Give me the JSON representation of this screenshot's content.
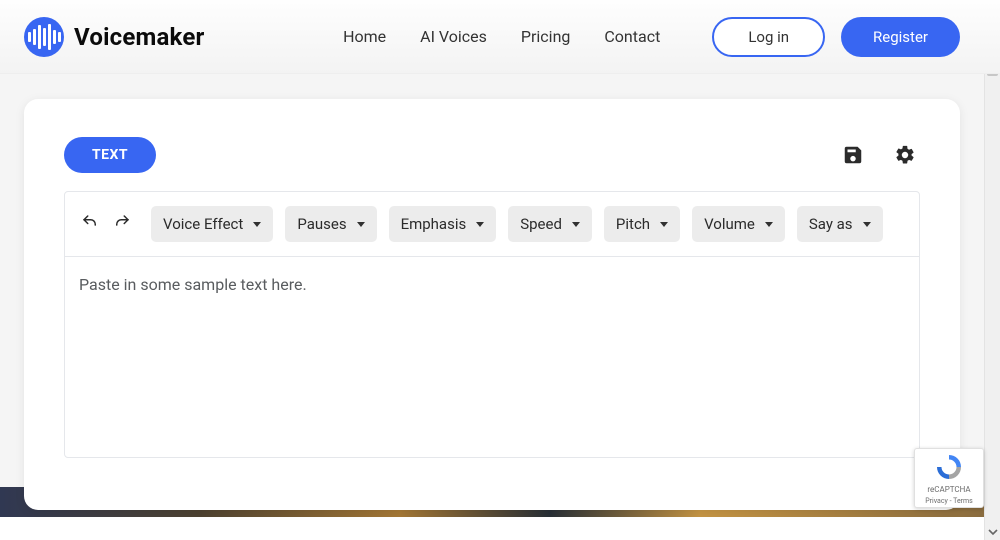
{
  "brand": {
    "name": "Voicemaker"
  },
  "nav": {
    "home": "Home",
    "ai_voices": "AI Voices",
    "pricing": "Pricing",
    "contact": "Contact"
  },
  "auth": {
    "login": "Log in",
    "register": "Register"
  },
  "tabs": {
    "text": "TEXT"
  },
  "toolbar": {
    "voice_effect": "Voice Effect",
    "pauses": "Pauses",
    "emphasis": "Emphasis",
    "speed": "Speed",
    "pitch": "Pitch",
    "volume": "Volume",
    "say_as": "Say as"
  },
  "editor": {
    "placeholder": "Paste in some sample text here."
  },
  "recaptcha": {
    "label": "reCAPTCHA",
    "terms": "Privacy - Terms"
  },
  "colors": {
    "accent": "#3866f2"
  }
}
